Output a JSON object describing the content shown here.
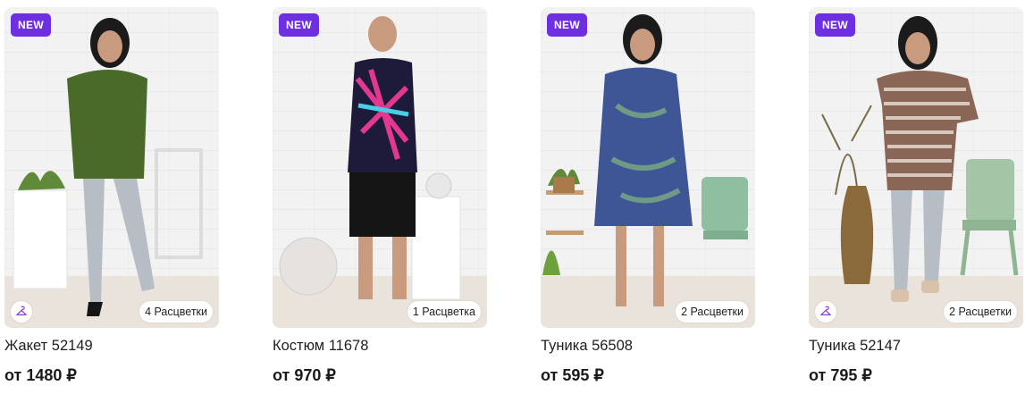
{
  "products": [
    {
      "badge": "NEW",
      "name": "Жакет 52149",
      "price": "от 1480 ₽",
      "colors": "4 Расцветки",
      "has_hanger": true
    },
    {
      "badge": "NEW",
      "name": "Костюм 11678",
      "price": "от 970 ₽",
      "colors": "1 Расцветка",
      "has_hanger": false
    },
    {
      "badge": "NEW",
      "name": "Туника 56508",
      "price": "от 595 ₽",
      "colors": "2 Расцветки",
      "has_hanger": false
    },
    {
      "badge": "NEW",
      "name": "Туника 52147",
      "price": "от 795 ₽",
      "colors": "2 Расцветки",
      "has_hanger": true
    }
  ],
  "colors": {
    "badge_bg": "#6d2fe0",
    "hanger_icon": "#8b3fd9"
  },
  "icons": {
    "hanger": "hanger-icon"
  }
}
